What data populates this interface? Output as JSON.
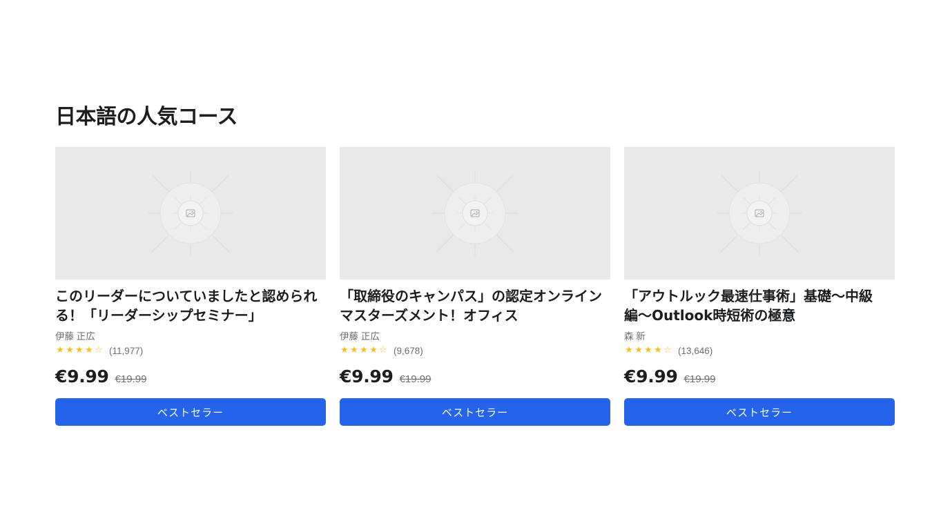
{
  "section": {
    "title": "日本語の人気コース"
  },
  "courses": [
    {
      "title": "このリーダーについていましたと認められる！「リーダーシップセミナー」",
      "instructor": "伊藤 正広",
      "rating": 4,
      "rating_max": 5,
      "reviews": "(11,977)",
      "price": "€9.99",
      "original_price": "€19.99",
      "badge": "ベストセラー",
      "thumbnail_icon": "image-placeholder-icon"
    },
    {
      "title": "「取締役のキャンパス」の認定オンラインマスターズメント！オフィス",
      "instructor": "伊藤 正広",
      "rating": 4,
      "rating_max": 5,
      "reviews": "(9,678)",
      "price": "€9.99",
      "original_price": "€19.99",
      "badge": "ベストセラー",
      "thumbnail_icon": "image-placeholder-icon"
    },
    {
      "title": "「アウトルック最速仕事術」基礎〜中級編〜Outlook時短術の極意",
      "instructor": "森 新",
      "rating": 4,
      "rating_max": 5,
      "reviews": "(13,646)",
      "price": "€9.99",
      "original_price": "€19.99",
      "badge": "ベストセラー",
      "thumbnail_icon": "image-placeholder-icon"
    }
  ],
  "colors": {
    "accent": "#2563eb",
    "star": "#f4c024",
    "thumbnail_bg": "#e9e9e9",
    "muted_text": "#6a6f73"
  }
}
